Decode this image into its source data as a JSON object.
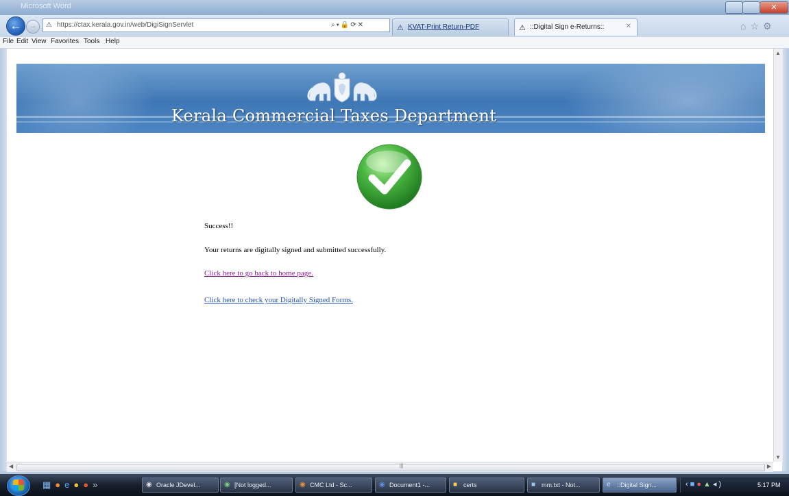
{
  "browser": {
    "window_title": "Microsoft Word",
    "address": "https://ctax.kerala.gov.in/web/DigiSignServlet",
    "tabs": [
      {
        "label": "KVAT-Print Return-PDF"
      },
      {
        "label": "::Digital Sign e-Returns::"
      }
    ],
    "menu": [
      "File",
      "Edit",
      "View",
      "Favorites",
      "Tools",
      "Help"
    ]
  },
  "page": {
    "banner_title": "Kerala Commercial Taxes Department",
    "status": "Success!!",
    "message": "Your returns are digitally signed and submitted successfully.",
    "link_home": "Click here to go back to home page.",
    "link_forms": "Click here to check your Digitally Signed Forms."
  },
  "taskbar": {
    "items": [
      {
        "label": "Oracle JDevel..."
      },
      {
        "label": "[Not logged..."
      },
      {
        "label": "CMC Ltd - Sc..."
      },
      {
        "label": "Document1 -..."
      },
      {
        "label": "certs"
      },
      {
        "label": "mm.txt - Not..."
      },
      {
        "label": "::Digital Sign..."
      }
    ],
    "clock": "5:17 PM"
  },
  "colors": {
    "banner": "#3f78b6",
    "visited_link": "#8b1c8b",
    "link": "#1f4fb0",
    "success_green": "#3ea83a"
  }
}
